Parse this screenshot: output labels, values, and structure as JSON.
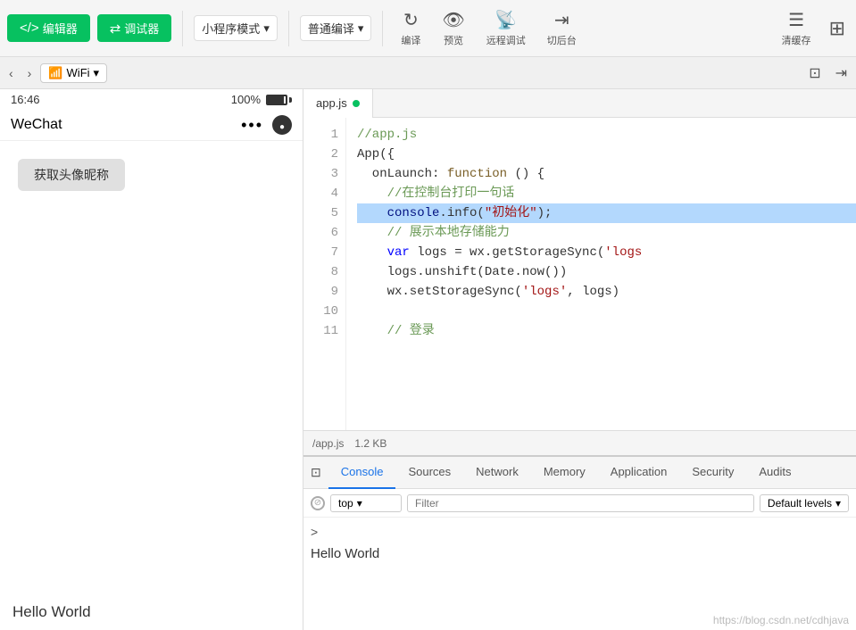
{
  "toolbar": {
    "editor_icon": "</> ",
    "editor_label": "编辑器",
    "debugger_icon": "⇄",
    "debugger_label": "调试器",
    "mode_label": "小程序模式",
    "compile_label": "普通编译",
    "refresh_label": "编译",
    "preview_label": "预览",
    "remote_debug_label": "远程调试",
    "cut_back_label": "切后台",
    "clear_cache_label": "清缓存"
  },
  "secondbar": {
    "wifi_label": "WiFi"
  },
  "filetab": {
    "filename": "app.js"
  },
  "phone": {
    "time": "16:46",
    "battery": "100%",
    "app_name": "WeChat",
    "get_avatar_btn": "获取头像昵称"
  },
  "editor": {
    "filepath": "/app.js",
    "filesize": "1.2 KB",
    "lines": [
      {
        "num": "1",
        "code": "//app.js",
        "type": "comment"
      },
      {
        "num": "2",
        "code": "App({",
        "type": "default"
      },
      {
        "num": "3",
        "code": "  onLaunch: function () {",
        "type": "mixed"
      },
      {
        "num": "4",
        "code": "    //在控制台打印一句话",
        "type": "comment"
      },
      {
        "num": "5",
        "code": "    console.info(\"初始化\");",
        "type": "highlighted"
      },
      {
        "num": "6",
        "code": "    // 展示本地存储能力",
        "type": "comment"
      },
      {
        "num": "7",
        "code": "    var logs = wx.getStorageSync('logs",
        "type": "default"
      },
      {
        "num": "8",
        "code": "    logs.unshift(Date.now())",
        "type": "default"
      },
      {
        "num": "9",
        "code": "    wx.setStorageSync('logs', logs)",
        "type": "default"
      },
      {
        "num": "10",
        "code": "",
        "type": "empty"
      },
      {
        "num": "11",
        "code": "    // 登录",
        "type": "comment"
      }
    ]
  },
  "devtools": {
    "tabs": [
      "Console",
      "Sources",
      "Network",
      "Memory",
      "Application",
      "Security",
      "Audits"
    ],
    "active_tab": "Console",
    "top_label": "top",
    "filter_placeholder": "Filter",
    "levels_label": "Default levels"
  },
  "console": {
    "prompt_char": ">",
    "hello_world": "Hello World"
  },
  "watermark": "https://blog.csdn.net/cdhjava"
}
